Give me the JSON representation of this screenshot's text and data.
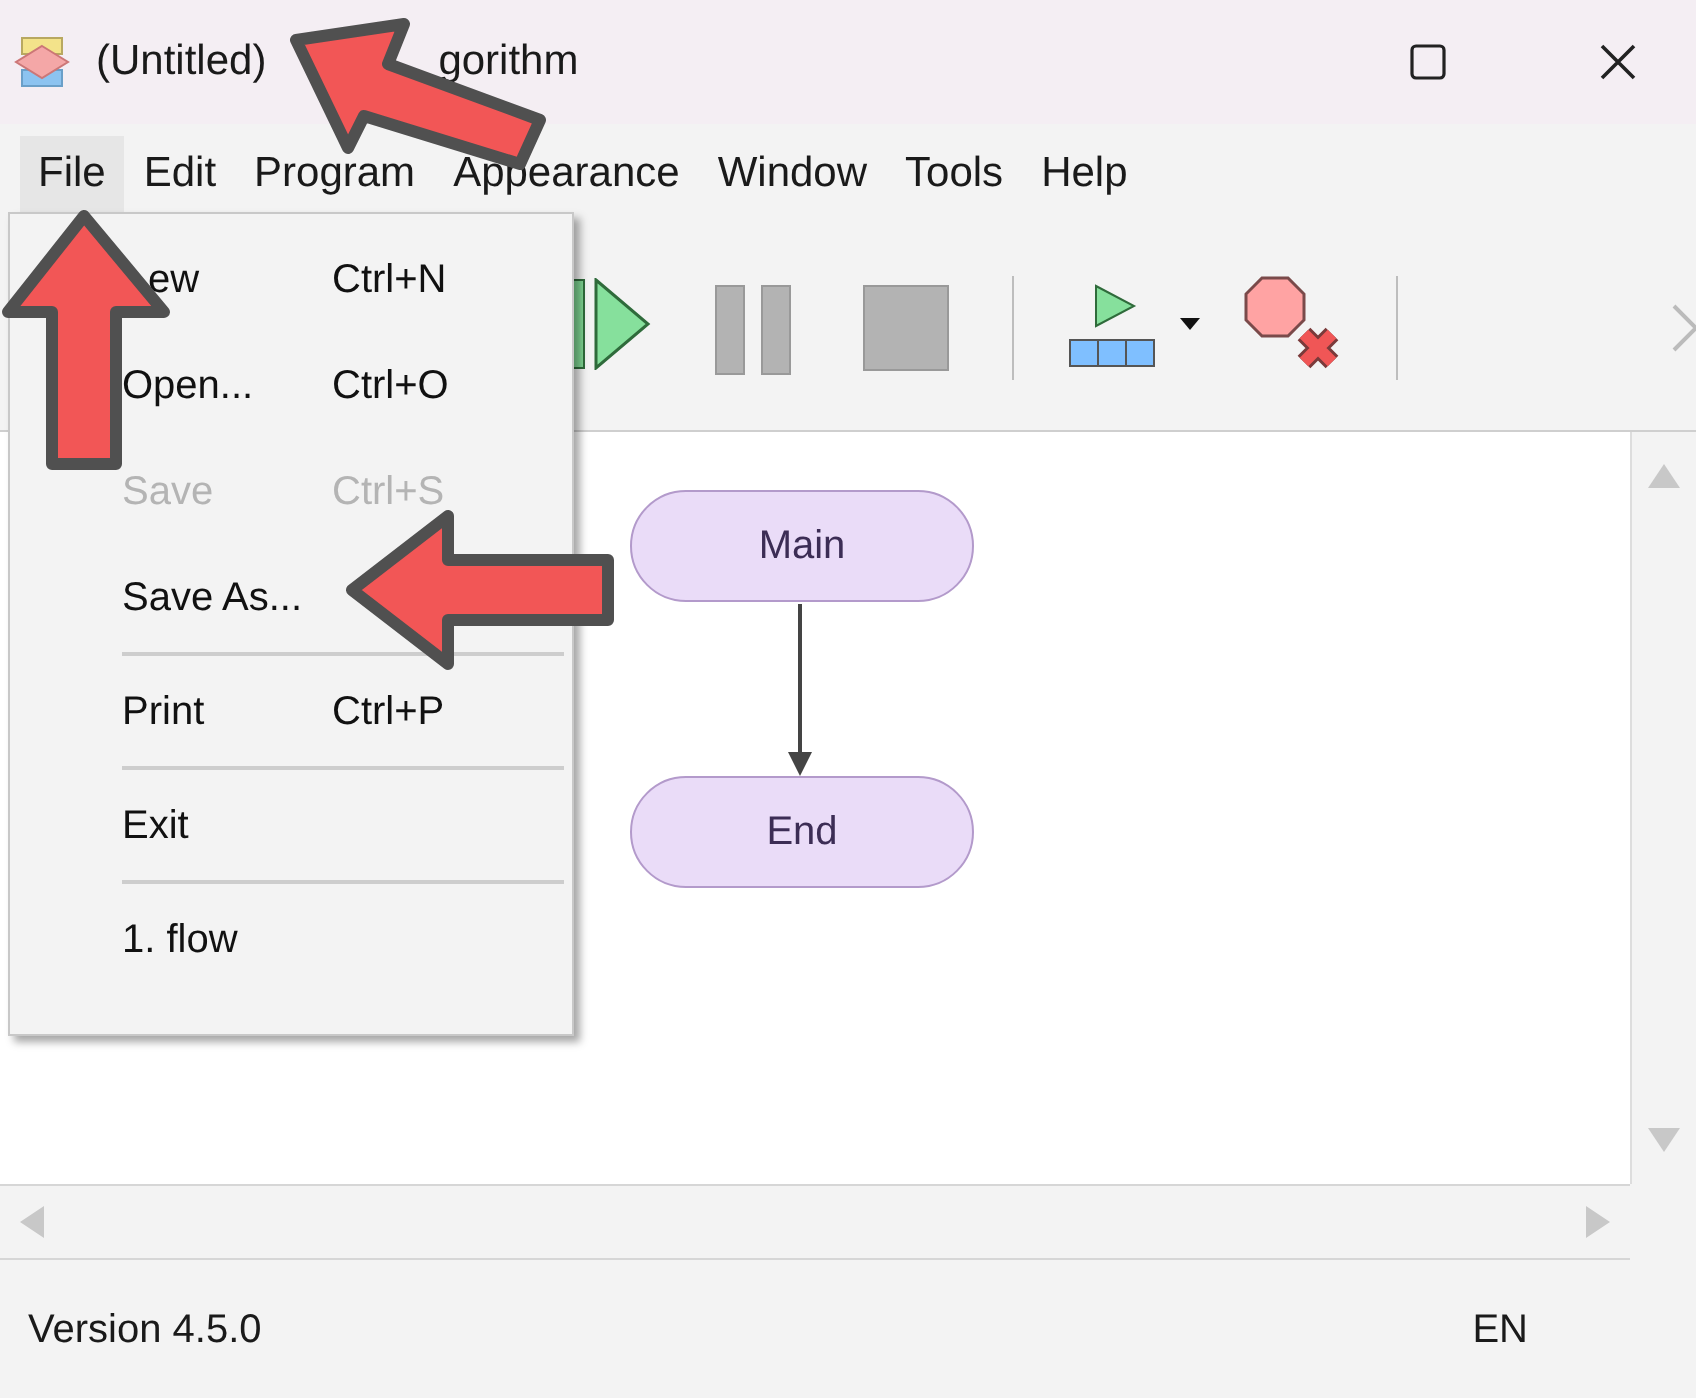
{
  "window": {
    "title_parts": [
      "(Untitled)",
      "gorithm"
    ]
  },
  "menu_bar": [
    {
      "label": "File",
      "selected": true
    },
    {
      "label": "Edit",
      "selected": false
    },
    {
      "label": "Program",
      "selected": false
    },
    {
      "label": "Appearance",
      "selected": false
    },
    {
      "label": "Window",
      "selected": false
    },
    {
      "label": "Tools",
      "selected": false
    },
    {
      "label": "Help",
      "selected": false
    }
  ],
  "file_menu": [
    {
      "kind": "item",
      "label": "ew",
      "shortcut": "Ctrl+N",
      "disabled": false
    },
    {
      "kind": "item",
      "label": "Open...",
      "shortcut": "Ctrl+O",
      "disabled": false
    },
    {
      "kind": "item",
      "label": "Save",
      "shortcut": "Ctrl+S",
      "disabled": true
    },
    {
      "kind": "item",
      "label": "Save As...",
      "disabled": false
    },
    {
      "kind": "separator"
    },
    {
      "kind": "item",
      "label": "Print",
      "shortcut": "Ctrl+P",
      "disabled": false
    },
    {
      "kind": "separator"
    },
    {
      "kind": "item",
      "label": "Exit",
      "disabled": false
    },
    {
      "kind": "separator"
    },
    {
      "kind": "item",
      "label": "1. flow",
      "disabled": false
    }
  ],
  "flowchart": {
    "nodes": [
      "Main",
      "End"
    ]
  },
  "status_bar": {
    "version": "Version 4.5.0",
    "language": "EN"
  }
}
